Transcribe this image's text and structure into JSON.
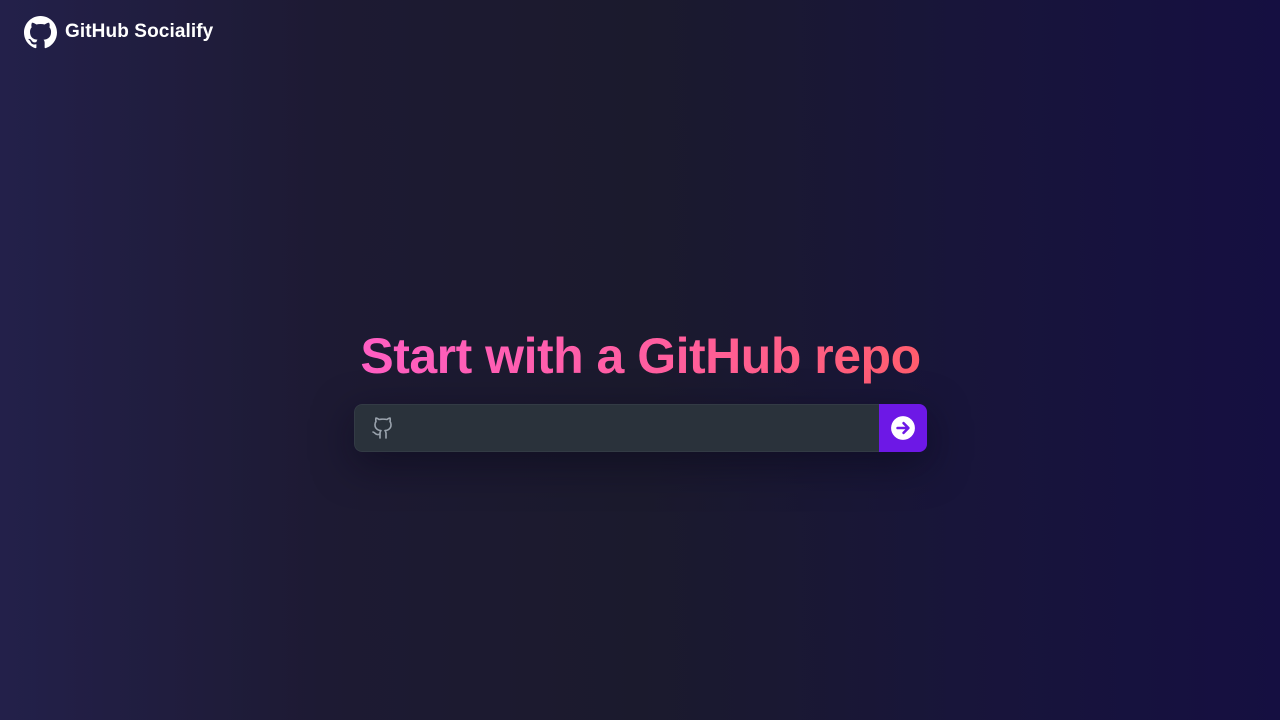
{
  "header": {
    "brand": "GitHub Socialify",
    "logo_icon": "github-icon"
  },
  "hero": {
    "title": "Start with a GitHub repo"
  },
  "search": {
    "value": "",
    "placeholder": "",
    "field_icon": "github-outline-icon",
    "submit_icon": "arrow-right-circle-icon"
  },
  "colors": {
    "accent": "#6d18e6",
    "headline_from": "#ff5ec4",
    "headline_to": "#ff5d6c",
    "field_bg": "#2a323b"
  }
}
